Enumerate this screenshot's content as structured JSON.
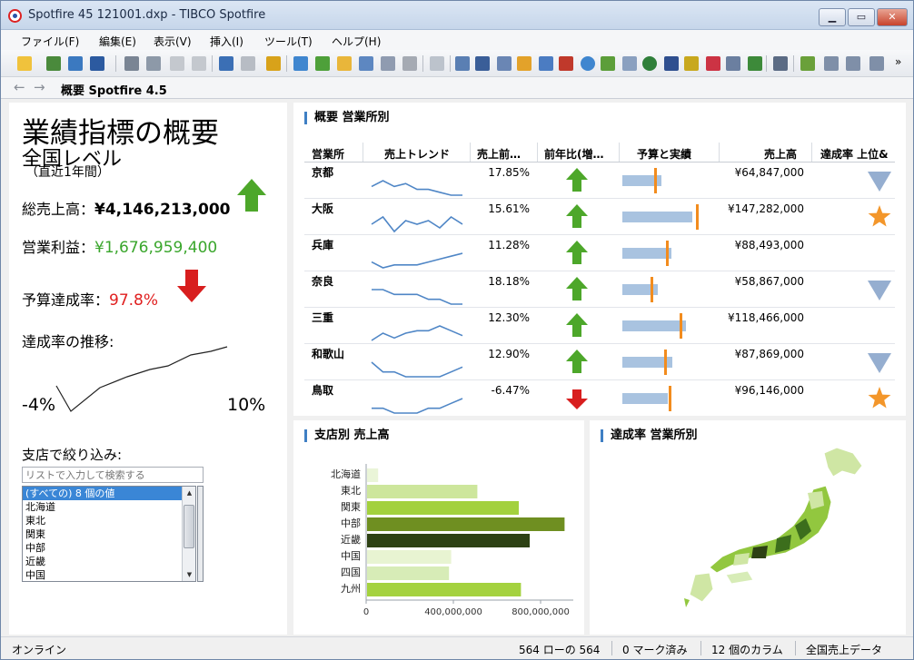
{
  "window": {
    "title": "Spotfire 45 121001.dxp - TIBCO Spotfire",
    "minimize_label": "▁",
    "maximize_label": "▭",
    "close_label": "✕"
  },
  "menu": [
    "ファイル(F)",
    "編集(E)",
    "表示(V)",
    "挿入(I)",
    "ツール(T)",
    "ヘルプ(H)"
  ],
  "nav": {
    "back_glyph": "←",
    "forward_glyph": "→",
    "page_title": "概要  Spotfire 4.5"
  },
  "kpi": {
    "title": "業績指標の概要",
    "subtitle": "全国レベル",
    "period": "（直近1年間）",
    "sales_label": "総売上高：",
    "sales_value": "¥4,146,213,000",
    "profit_label": "営業利益：",
    "profit_value": "¥1,676,959,400",
    "budget_label": "予算達成率：",
    "budget_value": "97.8%",
    "trend_label": "達成率の推移:",
    "trend_min": "-4%",
    "trend_max": "10%",
    "colors": {
      "up": "#4da72a",
      "down": "#d81e1e"
    }
  },
  "filter": {
    "label": "支店で絞り込み:",
    "placeholder": "リストで入力して検索する",
    "items": [
      "(すべての) 8 個の値",
      "北海道",
      "東北",
      "関東",
      "中部",
      "近畿",
      "中国"
    ]
  },
  "table_panel": {
    "title": "概要  営業所別",
    "headers": [
      "営業所",
      "売上トレンド",
      "売上前…",
      "前年比(増…",
      "予算と実績",
      "売上高",
      "達成率 上位&"
    ],
    "rows": [
      {
        "name": "京都",
        "pct": "17.85%",
        "trend": "up",
        "sales": "¥64,847,000",
        "badge": "down",
        "spark": [
          5,
          7,
          5,
          6,
          4,
          4,
          3,
          2,
          2
        ],
        "budget": 0.36,
        "actual": 0.43
      },
      {
        "name": "大阪",
        "pct": "15.61%",
        "trend": "up",
        "sales": "¥147,282,000",
        "badge": "star",
        "spark": [
          4,
          6,
          2,
          5,
          4,
          5,
          3,
          6,
          4
        ],
        "budget": 0.82,
        "actual": 0.77
      },
      {
        "name": "兵庫",
        "pct": "11.28%",
        "trend": "up",
        "sales": "¥88,493,000",
        "badge": "",
        "spark": [
          3,
          1,
          2,
          2,
          2,
          3,
          4,
          5,
          6
        ],
        "budget": 0.49,
        "actual": 0.54
      },
      {
        "name": "奈良",
        "pct": "18.18%",
        "trend": "up",
        "sales": "¥58,867,000",
        "badge": "down",
        "spark": [
          4,
          4,
          3,
          3,
          3,
          2,
          2,
          1,
          1
        ],
        "budget": 0.32,
        "actual": 0.39
      },
      {
        "name": "三重",
        "pct": "12.30%",
        "trend": "up",
        "sales": "¥118,466,000",
        "badge": "",
        "spark": [
          2,
          5,
          3,
          5,
          6,
          6,
          8,
          6,
          4
        ],
        "budget": 0.64,
        "actual": 0.7
      },
      {
        "name": "和歌山",
        "pct": "12.90%",
        "trend": "up",
        "sales": "¥87,869,000",
        "badge": "down",
        "spark": [
          5,
          3,
          3,
          2,
          2,
          2,
          2,
          3,
          4
        ],
        "budget": 0.47,
        "actual": 0.55
      },
      {
        "name": "鳥取",
        "pct": "-6.47%",
        "trend": "down",
        "sales": "¥96,146,000",
        "badge": "star",
        "spark": [
          1,
          1,
          0,
          0,
          0,
          1,
          1,
          2,
          3
        ],
        "budget": 0.52,
        "actual": 0.5
      }
    ],
    "colors": {
      "spark": "#4f86c6",
      "budget_bar": "#a9c3e0",
      "actual_marker": "#f28c1e",
      "badge_down": "#95aed0",
      "badge_star": "#f3962a"
    }
  },
  "bar_panel": {
    "title": "支店別  売上高",
    "tick_labels": [
      "0",
      "400,000,000",
      "800,000,000"
    ]
  },
  "map_panel": {
    "title": "達成率  営業所別",
    "colors": {
      "light": "#cfe6a4",
      "mid": "#92c73f",
      "dark": "#3c6e1c"
    }
  },
  "chart_data": {
    "type": "bar",
    "orientation": "horizontal",
    "title": "支店別  売上高",
    "categories": [
      "北海道",
      "東北",
      "関東",
      "中部",
      "近畿",
      "中国",
      "四国",
      "九州"
    ],
    "values": [
      55000000,
      510000000,
      700000000,
      910000000,
      750000000,
      390000000,
      380000000,
      710000000
    ],
    "xlim": [
      0,
      950000000
    ],
    "xticks": [
      0,
      400000000,
      800000000
    ],
    "colors": [
      "#eaf5d8",
      "#cde69c",
      "#a3d13e",
      "#6f8f21",
      "#2d4114",
      "#e8f4d2",
      "#d7ecb7",
      "#a4d23f"
    ],
    "grid": false
  },
  "status": {
    "left": "オンライン",
    "rows": "564 ローの 564",
    "marked": "0 マーク済み",
    "columns": "12 個のカラム",
    "table": "全国売上データ"
  }
}
